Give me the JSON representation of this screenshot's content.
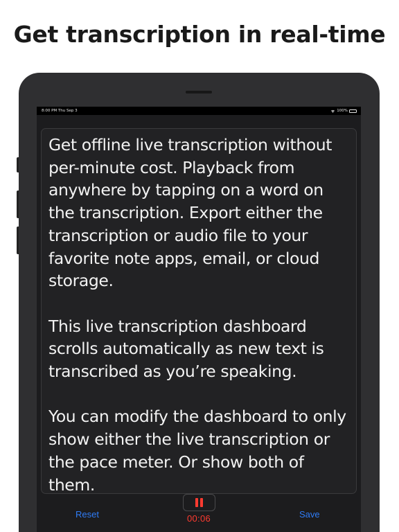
{
  "headline": "Get transcription in real-time",
  "status_bar": {
    "time_date": "8:00 PM  Thu Sep 3",
    "battery": "100%",
    "wifi_icon": "wifi-icon",
    "battery_icon": "battery-icon"
  },
  "transcription": {
    "paragraphs": [
      "Get offline live transcription without per-minute cost. Playback from anywhere by tapping on a word on the transcription. Export either the transcription or audio file to your favorite note apps, email, or cloud storage.",
      "This live transcription dashboard scrolls automatically as new text is transcribed as you’re speaking.",
      "You can modify the dashboard to only show either the live transcription or the pace meter. Or show both of them."
    ]
  },
  "controls": {
    "reset_label": "Reset",
    "save_label": "Save",
    "pause_icon": "pause-icon",
    "timer": "00:06"
  },
  "colors": {
    "accent_blue": "#2f7cf6",
    "record_red": "#ff3b30",
    "background_dark": "#1c1c1e"
  }
}
